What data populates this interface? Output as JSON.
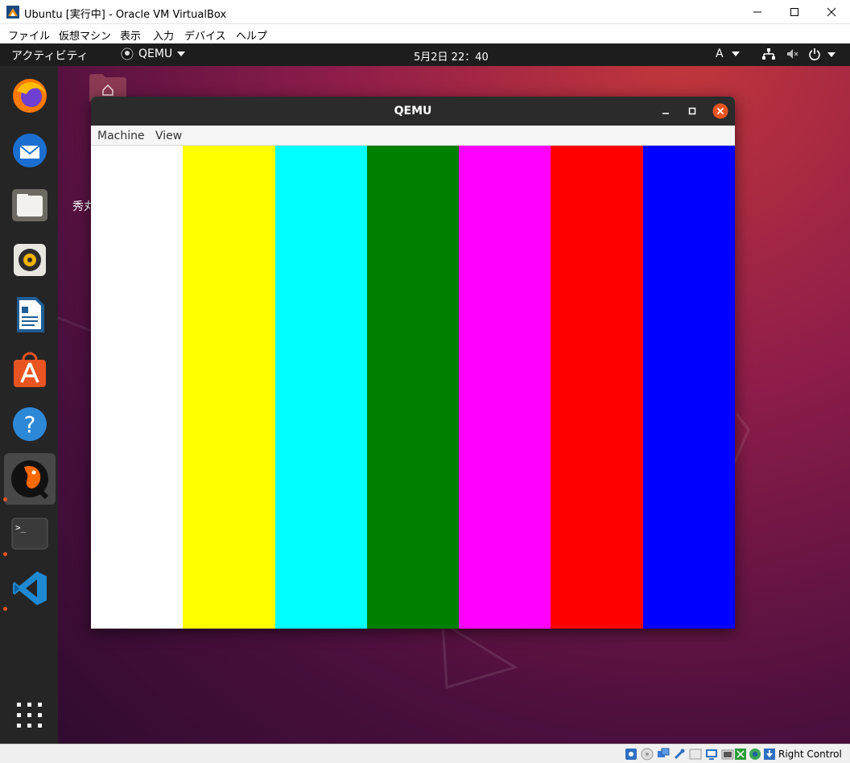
{
  "host_window": {
    "title": "Ubuntu [実行中] - Oracle VM VirtualBox",
    "menu": [
      "ファイル",
      "仮想マシン",
      "表示",
      "入力",
      "デバイス",
      "ヘルプ"
    ],
    "controls": [
      "minimize-icon",
      "maximize-icon",
      "close-icon"
    ]
  },
  "topbar": {
    "activities": "アクティビティ",
    "app_name": "QEMU",
    "clock": "5月2日  22：40",
    "input_source": "A",
    "status_icons": [
      "network-icon",
      "volume-mute-icon",
      "power-icon"
    ]
  },
  "dock": {
    "items": [
      {
        "name": "firefox",
        "icon": "firefox-icon",
        "running": false
      },
      {
        "name": "thunderbird",
        "icon": "thunderbird-icon",
        "running": false
      },
      {
        "name": "files",
        "icon": "files-icon",
        "running": false
      },
      {
        "name": "rhythmbox",
        "icon": "rhythmbox-icon",
        "running": false
      },
      {
        "name": "libreoffice-writer",
        "icon": "writer-icon",
        "running": false
      },
      {
        "name": "ubuntu-software",
        "icon": "software-icon",
        "running": false
      },
      {
        "name": "help",
        "icon": "help-icon",
        "running": false
      },
      {
        "name": "qemu",
        "icon": "qemu-icon",
        "running": true,
        "active": true
      },
      {
        "name": "terminal",
        "icon": "terminal-icon",
        "running": true
      },
      {
        "name": "vscode",
        "icon": "vscode-icon",
        "running": true
      }
    ],
    "show_apps_icon": "app-grid-icon"
  },
  "desktop": {
    "home_label_partial": "秀丸"
  },
  "qemu_window": {
    "title": "QEMU",
    "menu": [
      "Machine",
      "View"
    ],
    "color_bars": [
      "#ffffff",
      "#ffff00",
      "#00ffff",
      "#008000",
      "#ff00ff",
      "#ff0000",
      "#0000ff"
    ]
  },
  "statusbar": {
    "host_key": "Right Control",
    "icons": [
      "hdd-icon",
      "optical-icon",
      "network-adapter-icon",
      "usb-icon",
      "shared-folder-icon",
      "display-icon",
      "video-capture-icon",
      "mouse-integration-icon",
      "cpu-icon",
      "host-key-arrow-icon"
    ]
  },
  "colors": {
    "ubuntu_orange": "#e95420",
    "topbar_bg": "#1d1d1d",
    "dock_bg": "#252525"
  }
}
